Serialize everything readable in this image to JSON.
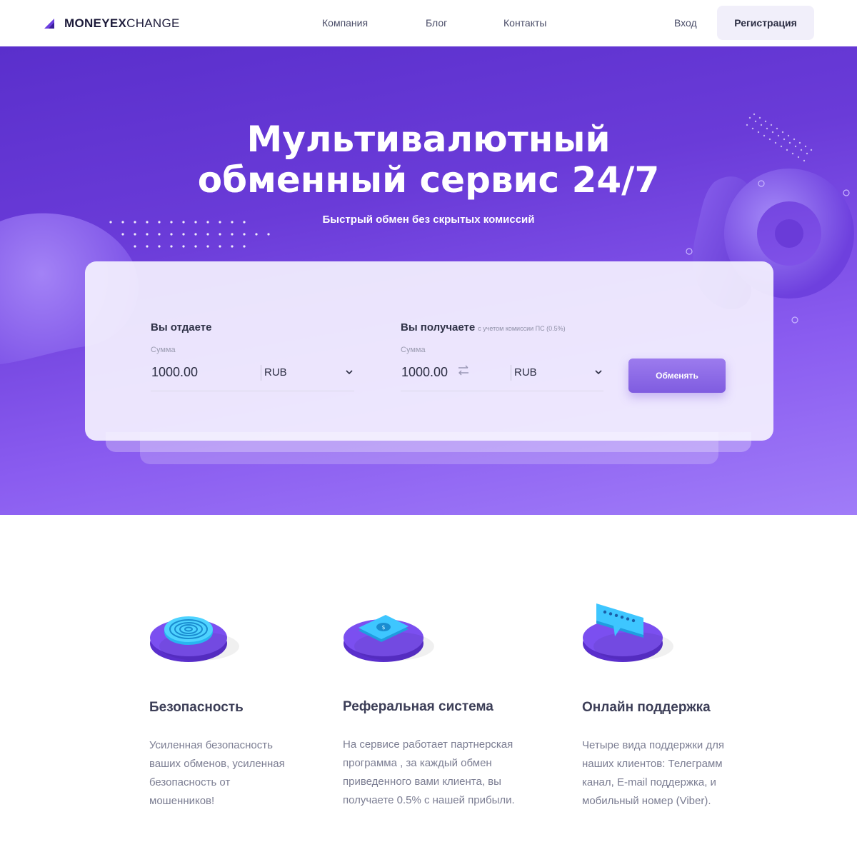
{
  "header": {
    "logo_bold": "MONEYEX",
    "logo_light": "CHANGE",
    "nav": [
      "Компания",
      "Блог",
      "Контакты"
    ],
    "login": "Вход",
    "register": "Регистрация"
  },
  "hero": {
    "title_line1": "Мультивалютный",
    "title_line2": "обменный сервис 24/7",
    "subtitle": "Быстрый обмен без скрытых комиссий"
  },
  "exchange": {
    "give": {
      "label": "Вы отдаете",
      "sum_label": "Сумма",
      "amount": "1000.00",
      "currency": "RUB"
    },
    "receive": {
      "label": "Вы получаете",
      "note": "с учетом комиссии ПС (0.5%)",
      "sum_label": "Сумма",
      "amount": "1000.00",
      "currency": "RUB"
    },
    "button": "Обменять"
  },
  "features": [
    {
      "icon": "fingerprint-icon",
      "title": "Безопасность",
      "lines": [
        "Усиленная безопасность",
        "ваших обменов, усиленная",
        "безопасность от",
        "мошенников!"
      ]
    },
    {
      "icon": "money-bill-icon",
      "title": "Реферальная система",
      "lines": [
        "На сервисе работает партнерская",
        "программа , за каждый обмен",
        "приведенного вами клиента, вы",
        "получаете 0.5% с нашей прибыли."
      ]
    },
    {
      "icon": "chat-password-icon",
      "title": "Онлайн поддержка",
      "lines": [
        "Четыре вида поддержки для",
        "наших клиентов: Телеграмм",
        "канал, E-mail поддержка, и",
        "мобильный номер (Viber)."
      ]
    }
  ],
  "colors": {
    "hero_start": "#5a2fcc",
    "hero_end": "#a07cf8",
    "accent": "#7f5ce0",
    "heading": "#3c3e57",
    "body_text": "#7b7d92"
  }
}
